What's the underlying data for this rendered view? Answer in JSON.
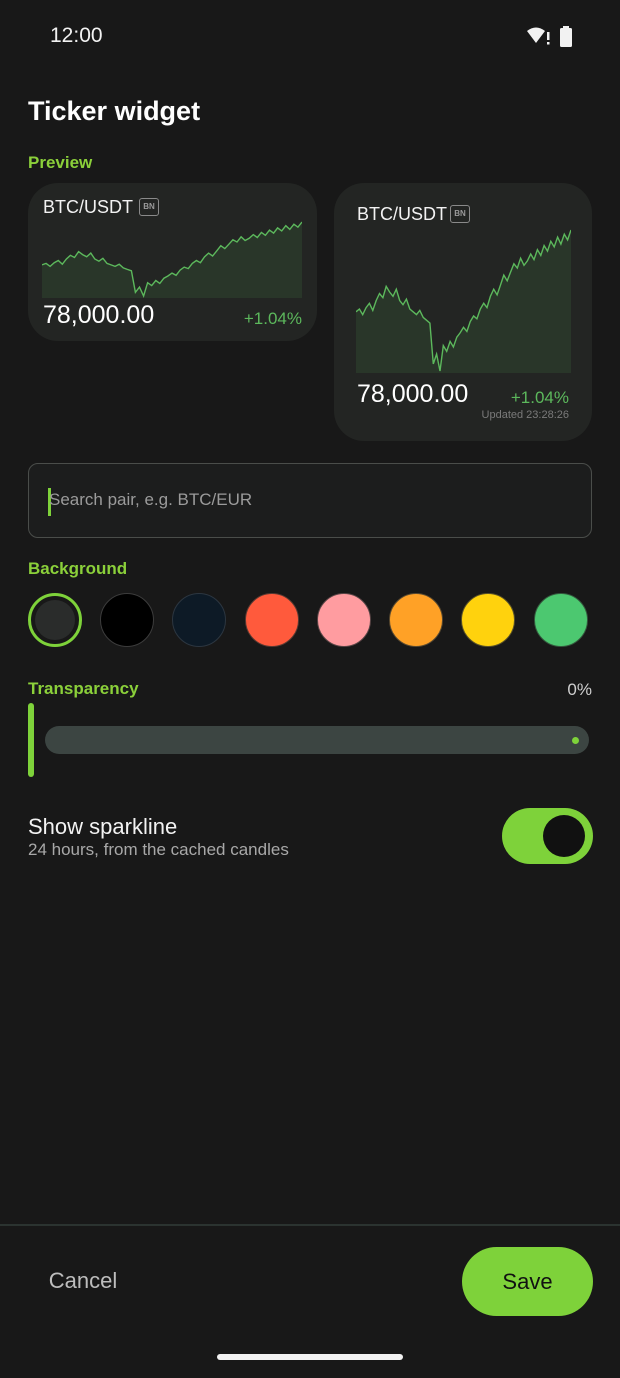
{
  "status_bar": {
    "time": "12:00",
    "icons": [
      "wifi-alert-icon",
      "battery-icon"
    ]
  },
  "page": {
    "title": "Ticker widget"
  },
  "preview": {
    "label": "Preview",
    "small_card": {
      "pair": "BTC/USDT",
      "exchange_badge": "BN",
      "price": "78,000.00",
      "change": "+1.04%"
    },
    "large_card": {
      "pair": "BTC/USDT",
      "exchange_badge": "BN",
      "price": "78,000.00",
      "change": "+1.04%",
      "updated": "Updated 23:28:26"
    },
    "sparkline_color": "#5cb85c"
  },
  "search": {
    "placeholder": "Search pair, e.g. BTC/EUR",
    "value": ""
  },
  "background": {
    "label": "Background",
    "swatches": [
      {
        "name": "dark-gray",
        "color": "#2a2c2b",
        "selected": true
      },
      {
        "name": "black",
        "color": "#000000",
        "selected": false
      },
      {
        "name": "navy",
        "color": "#0d1a26",
        "selected": false
      },
      {
        "name": "red",
        "color": "#ff5a3c",
        "selected": false
      },
      {
        "name": "pink",
        "color": "#ff9ca0",
        "selected": false
      },
      {
        "name": "orange",
        "color": "#ffa126",
        "selected": false
      },
      {
        "name": "yellow",
        "color": "#ffd20d",
        "selected": false
      },
      {
        "name": "green",
        "color": "#4cc870",
        "selected": false
      }
    ]
  },
  "transparency": {
    "label": "Transparency",
    "value_text": "0%",
    "value": 0
  },
  "sparkline_toggle": {
    "title": "Show sparkline",
    "subtitle": "24 hours, from the cached candles",
    "on": true
  },
  "footer": {
    "cancel_label": "Cancel",
    "save_label": "Save"
  },
  "colors": {
    "accent": "#7ed23a",
    "background": "#181818",
    "card": "#232523",
    "positive": "#5cb85c"
  }
}
